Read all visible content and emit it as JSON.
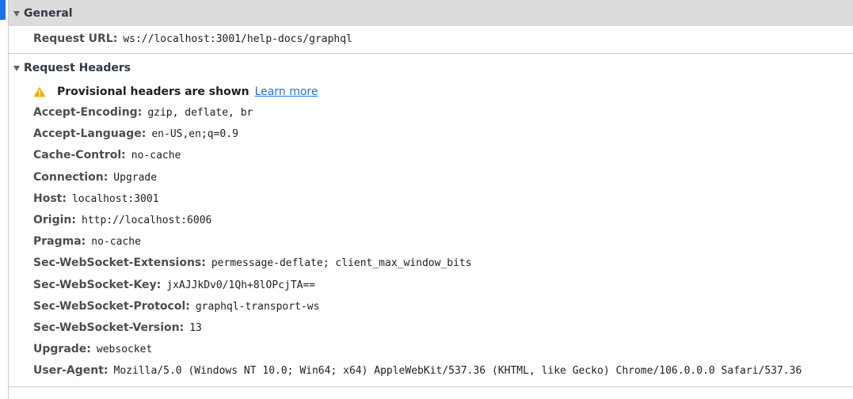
{
  "general": {
    "title": "General",
    "request_url_label": "Request URL:",
    "request_url_value": "ws://localhost:3001/help-docs/graphql"
  },
  "request_headers": {
    "title": "Request Headers",
    "provisional_text": "Provisional headers are shown",
    "learn_more": "Learn more",
    "rows": [
      {
        "name": "Accept-Encoding:",
        "value": "gzip, deflate, br"
      },
      {
        "name": "Accept-Language:",
        "value": "en-US,en;q=0.9"
      },
      {
        "name": "Cache-Control:",
        "value": "no-cache"
      },
      {
        "name": "Connection:",
        "value": "Upgrade"
      },
      {
        "name": "Host:",
        "value": "localhost:3001"
      },
      {
        "name": "Origin:",
        "value": "http://localhost:6006"
      },
      {
        "name": "Pragma:",
        "value": "no-cache"
      },
      {
        "name": "Sec-WebSocket-Extensions:",
        "value": "permessage-deflate; client_max_window_bits"
      },
      {
        "name": "Sec-WebSocket-Key:",
        "value": "jxAJJkDv0/1Qh+8lOPcjTA=="
      },
      {
        "name": "Sec-WebSocket-Protocol:",
        "value": "graphql-transport-ws"
      },
      {
        "name": "Sec-WebSocket-Version:",
        "value": "13"
      },
      {
        "name": "Upgrade:",
        "value": "websocket"
      },
      {
        "name": "User-Agent:",
        "value": "Mozilla/5.0 (Windows NT 10.0; Win64; x64) AppleWebKit/537.36 (KHTML, like Gecko) Chrome/106.0.0.0 Safari/537.36"
      }
    ]
  },
  "icons": {
    "section_toggle": "triangle-down-icon",
    "provisional_warning": "warning-icon"
  },
  "colors": {
    "link": "#1a73e8",
    "warning": "#f9ab00",
    "general_header_bg": "#dcdcdc",
    "selection": "#1a73e8"
  }
}
